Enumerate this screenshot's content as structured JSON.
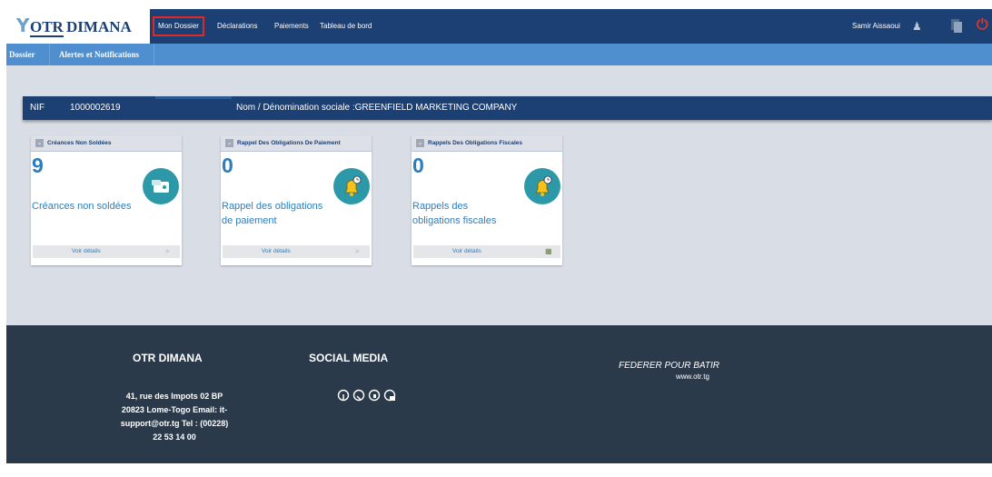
{
  "header": {
    "logo_otr": "OTR",
    "logo_dimana": "DIMANA",
    "nav": [
      "Mon Dossier",
      "Déclarations",
      "Paiements",
      "Tableau de bord"
    ],
    "user_name": "Samir Aissaoui",
    "icons": [
      "user-icon",
      "document-icon",
      "power-icon"
    ]
  },
  "subnav": [
    "Dossier",
    "Alertes et Notifications"
  ],
  "taxpayer": {
    "nif_label": "NIF",
    "nif_value": "1000002619",
    "name_text": "Nom / Dénomination sociale :GREENFIELD MARKETING COMPANY"
  },
  "cards": [
    {
      "title": "Créances Non Soldées",
      "count": "9",
      "label_lines": [
        "Créances non soldées"
      ],
      "link": "Voir détails",
      "icon": "wallet-icon"
    },
    {
      "title": "Rappel Des Obligations De Paiement",
      "count": "0",
      "label_lines": [
        "Rappel des obligations",
        "de paiement"
      ],
      "link": "Voir détails",
      "icon": "bell-clock-icon"
    },
    {
      "title": "Rappels Des Obligations Fiscales",
      "count": "0",
      "label_lines": [
        "Rappels des",
        "obligations fiscales"
      ],
      "link": "Voir détails",
      "icon": "bell-clock-icon"
    }
  ],
  "footer": {
    "brand": "OTR DIMANA",
    "address_lines": [
      "41, rue des Impots 02 BP",
      "20823 Lome-Togo Email: it-",
      "support@otr.tg Tel : (00228)",
      "22 53 14 00"
    ],
    "social_title": "SOCIAL MEDIA",
    "slogan": "FEDERER POUR BATIR",
    "website": "www.otr.tg"
  },
  "colors": {
    "navbar": "#1c3f74",
    "subbar": "#4f8fcf",
    "accent": "#2d7dbb",
    "footer": "#2b3a4b",
    "highlight": "#e02a2a"
  }
}
